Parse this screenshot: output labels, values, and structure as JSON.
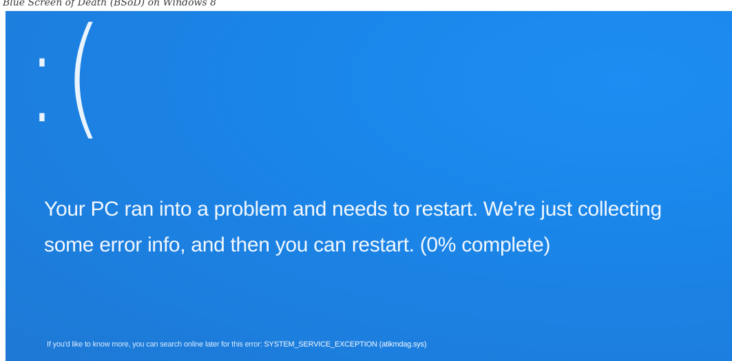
{
  "caption": "Blue Screen of Death (BSoD) on Windows 8",
  "colors": {
    "background": "#1a86ea",
    "text": "#f2f8ff"
  },
  "sad_face": ":(",
  "message": "Your PC ran into a problem and needs to restart. We're just collecting some error info, and then you can restart. (0% complete)",
  "progress_percent": 0,
  "footnote": {
    "prefix": "If you'd like to know more, you can search online later for this error:",
    "error_code": "SYSTEM_SERVICE_EXCEPTION (atikmdag.sys)"
  }
}
